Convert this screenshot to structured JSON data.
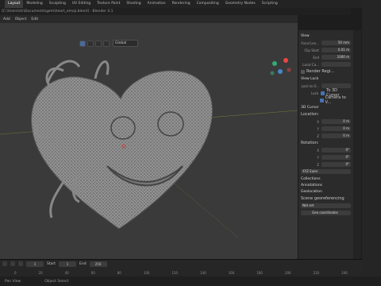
{
  "workspace_tabs": [
    "Layout",
    "Modeling",
    "Sculpting",
    "UV Editing",
    "Texture Paint",
    "Shading",
    "Animation",
    "Rendering",
    "Compositing",
    "Geometry Nodes",
    "Scripting"
  ],
  "active_tab": "Layout",
  "path": "[C:\\Users\\dc\\Documents\\gem\\heart_emoji.blend] - Blender 4.1",
  "viewport_header": {
    "mode_items": [
      "Add",
      "Object",
      "Edit"
    ],
    "transform": "Global"
  },
  "npanel": {
    "view_title": "View",
    "focal_label": "Focal Len...",
    "focal_value": "50 mm",
    "clip_start_label": "Clip Start",
    "clip_start_value": "0.01 m",
    "clip_end_label": "End",
    "clip_end_value": "1000 m",
    "local_camera_label": "Local Ca...",
    "render_region_label": "Render Regi...",
    "view_lock_title": "View Lock",
    "lock_object_label": "Lock to O...",
    "lock_label": "Lock",
    "lock_3d_cursor": "To 3D Cursor",
    "camera_to_view": "Camera to V...",
    "cursor_title": "3D Cursor",
    "location_label": "Location:",
    "loc_x_label": "X",
    "loc_x": "0 m",
    "loc_y_label": "Y",
    "loc_y": "0 m",
    "loc_z_label": "Z",
    "loc_z": "0 m",
    "rotation_label": "Rotation:",
    "rot_x_label": "X",
    "rot_x": "0°",
    "rot_y_label": "Y",
    "rot_y": "0°",
    "rot_z_label": "Z",
    "rot_z": "0°",
    "rot_mode": "XYZ Euler",
    "collections": "Collections",
    "annotations": "Annotations",
    "geo_title": "Geolocation",
    "scene_geo": "Scene georeferencing",
    "not_set": "Not set",
    "geo_button": "Geo coordinates"
  },
  "timeline": {
    "labels": [
      "0",
      "10",
      "20",
      "30",
      "40",
      "50",
      "60",
      "70",
      "80",
      "90",
      "100",
      "110",
      "120",
      "130",
      "140",
      "150",
      "160",
      "170",
      "180",
      "190",
      "200",
      "210",
      "220",
      "230",
      "240",
      "250"
    ],
    "start_label": "Start",
    "start": "1",
    "end_label": "End",
    "end": "250",
    "current": "1"
  },
  "status": {
    "left": "Pan View",
    "middle": "Object Select"
  },
  "colors": {
    "accent": "#4772b3",
    "bg": "#3a3a3a"
  }
}
